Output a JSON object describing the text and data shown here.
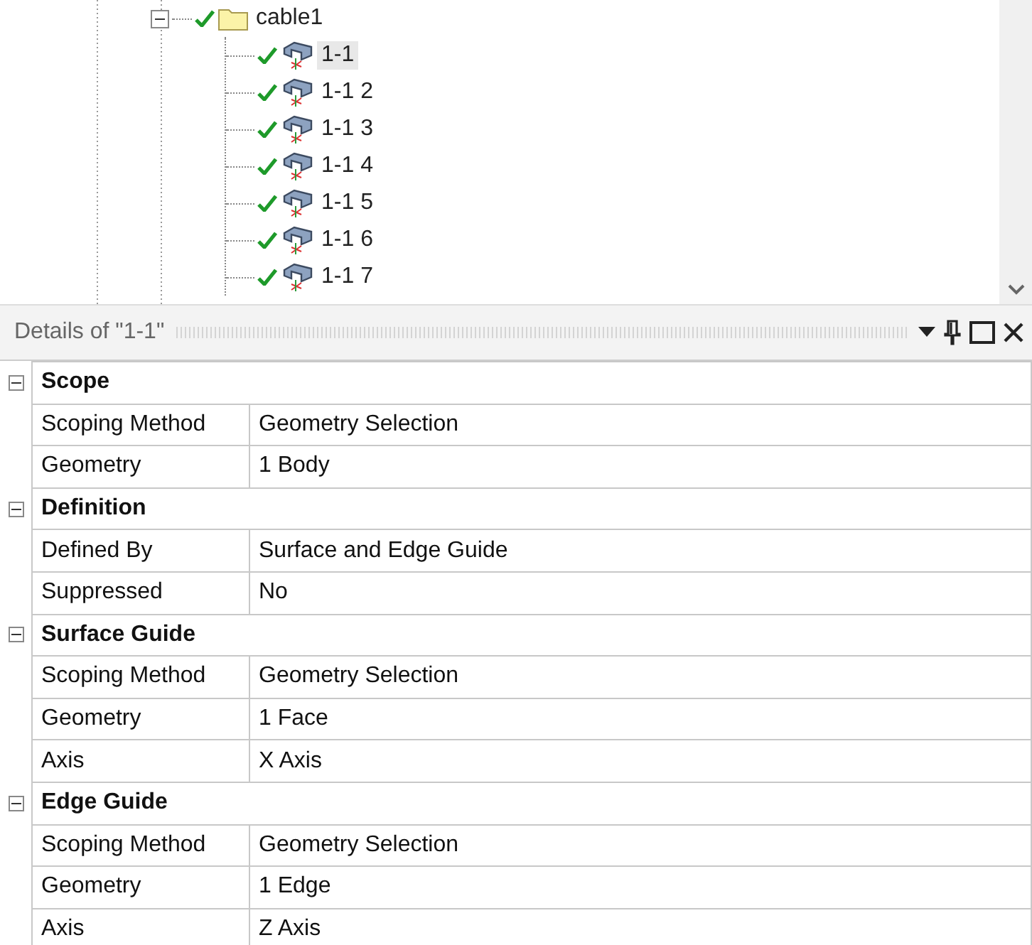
{
  "tree": {
    "items": [
      {
        "label": "cable1",
        "expanded": true,
        "children": [
          {
            "label": "1-1",
            "selected": true
          },
          {
            "label": "1-1 2",
            "selected": false
          },
          {
            "label": "1-1 3",
            "selected": false
          },
          {
            "label": "1-1 4",
            "selected": false
          },
          {
            "label": "1-1 5",
            "selected": false
          },
          {
            "label": "1-1 6",
            "selected": false
          },
          {
            "label": "1-1 7",
            "selected": false
          }
        ]
      }
    ]
  },
  "details": {
    "title": "Details of \"1-1\"",
    "sections": [
      {
        "title": "Scope",
        "expanded": true,
        "rows": [
          {
            "label": "Scoping Method",
            "value": "Geometry Selection"
          },
          {
            "label": "Geometry",
            "value": "1 Body"
          }
        ]
      },
      {
        "title": "Definition",
        "expanded": true,
        "rows": [
          {
            "label": "Defined By",
            "value": "Surface and Edge Guide"
          },
          {
            "label": "Suppressed",
            "value": "No"
          }
        ]
      },
      {
        "title": "Surface Guide",
        "expanded": true,
        "rows": [
          {
            "label": "Scoping Method",
            "value": "Geometry Selection"
          },
          {
            "label": "Geometry",
            "value": "1 Face"
          },
          {
            "label": "Axis",
            "value": "X Axis"
          }
        ]
      },
      {
        "title": "Edge Guide",
        "expanded": true,
        "rows": [
          {
            "label": "Scoping Method",
            "value": "Geometry Selection"
          },
          {
            "label": "Geometry",
            "value": "1 Edge"
          },
          {
            "label": "Axis",
            "value": "Z Axis"
          }
        ]
      }
    ]
  }
}
